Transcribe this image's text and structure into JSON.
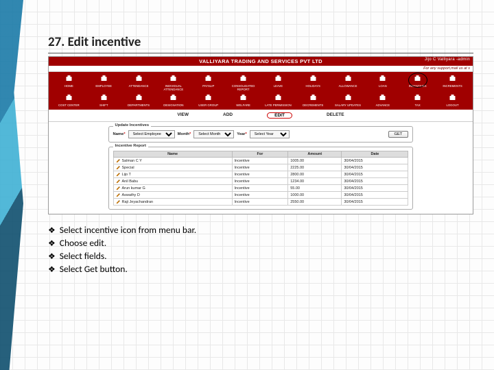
{
  "slide": {
    "title": "27. Edit incentive"
  },
  "app": {
    "company": "VALLIYARA TRADING AND SERVICES PVT LTD",
    "user": "Jijo C Valliyara -admin",
    "support": "For any support,mail us at s"
  },
  "menu": {
    "row1": [
      {
        "name": "home-icon",
        "label": "HOME"
      },
      {
        "name": "employee-icon",
        "label": "EMPLOYEE"
      },
      {
        "name": "attendance-icon",
        "label": "ATTENDANCE"
      },
      {
        "name": "individual-attendance-icon",
        "label": "INDIVIDUAL ATTENDANCE"
      },
      {
        "name": "payslip-icon",
        "label": "PAYSLIP"
      },
      {
        "name": "consolidated-report-icon",
        "label": "CONSOLIDATED REPORT"
      },
      {
        "name": "leave-icon",
        "label": "LEAVE"
      },
      {
        "name": "holidays-icon",
        "label": "HOLIDAYS"
      },
      {
        "name": "allowance-icon",
        "label": "ALLOWANCE"
      },
      {
        "name": "loan-icon",
        "label": "LOAN"
      },
      {
        "name": "incentives-icon",
        "label": "INCENTIVES",
        "circled": true
      },
      {
        "name": "increments-icon",
        "label": "INCREMENTS"
      }
    ],
    "row2": [
      {
        "name": "cost-center-icon",
        "label": "COST CENTER"
      },
      {
        "name": "shift-icon",
        "label": "SHIFT"
      },
      {
        "name": "departments-icon",
        "label": "DEPARTMENTS"
      },
      {
        "name": "designation-icon",
        "label": "DESIGNATION"
      },
      {
        "name": "user-group-icon",
        "label": "USER GROUP"
      },
      {
        "name": "welfare-icon",
        "label": "WELFARE"
      },
      {
        "name": "late-permission-icon",
        "label": "LATE PERMISSION"
      },
      {
        "name": "decrements-icon",
        "label": "DECREMENTS"
      },
      {
        "name": "salary-updates-icon",
        "label": "SALARY UPDATES"
      },
      {
        "name": "advance-icon",
        "label": "ADVANCE"
      },
      {
        "name": "tax-icon",
        "label": "TAX"
      },
      {
        "name": "logout-icon",
        "label": "LOGOUT"
      }
    ]
  },
  "tabs": {
    "view": "VIEW",
    "add": "ADD",
    "edit": "EDIT",
    "delete": "DELETE",
    "active": "edit"
  },
  "form": {
    "legend": "Update Incentives",
    "name_label": "Name",
    "name_value": "Select Employee",
    "month_label": "Month",
    "month_value": "Select Month",
    "year_label": "Year",
    "year_value": "Select Year",
    "get": "GET"
  },
  "report": {
    "legend": "Incentive Report",
    "headers": {
      "name": "Name",
      "for": "For",
      "amount": "Amount",
      "date": "Date"
    },
    "rows": [
      {
        "name": "Salman C Y",
        "for": "Incentive",
        "amount": "1005.00",
        "date": "30/04/2015"
      },
      {
        "name": "Special",
        "for": "Incentive",
        "amount": "2225.00",
        "date": "30/04/2015"
      },
      {
        "name": "Lijo T",
        "for": "Incentive",
        "amount": "2800.00",
        "date": "30/04/2015"
      },
      {
        "name": "Anil Babu",
        "for": "Incentive",
        "amount": "1234.00",
        "date": "30/04/2015"
      },
      {
        "name": "Arun kumar G",
        "for": "Incentive",
        "amount": "55.00",
        "date": "30/04/2015"
      },
      {
        "name": "Aswathy D",
        "for": "Incentive",
        "amount": "1000.00",
        "date": "30/04/2015"
      },
      {
        "name": "Raji Jeyachandran",
        "for": "Incentive",
        "amount": "2550.00",
        "date": "30/04/2015"
      }
    ]
  },
  "bullets": [
    "Select incentive icon from menu bar.",
    "Choose edit.",
    "Select fields.",
    "Select Get button."
  ]
}
